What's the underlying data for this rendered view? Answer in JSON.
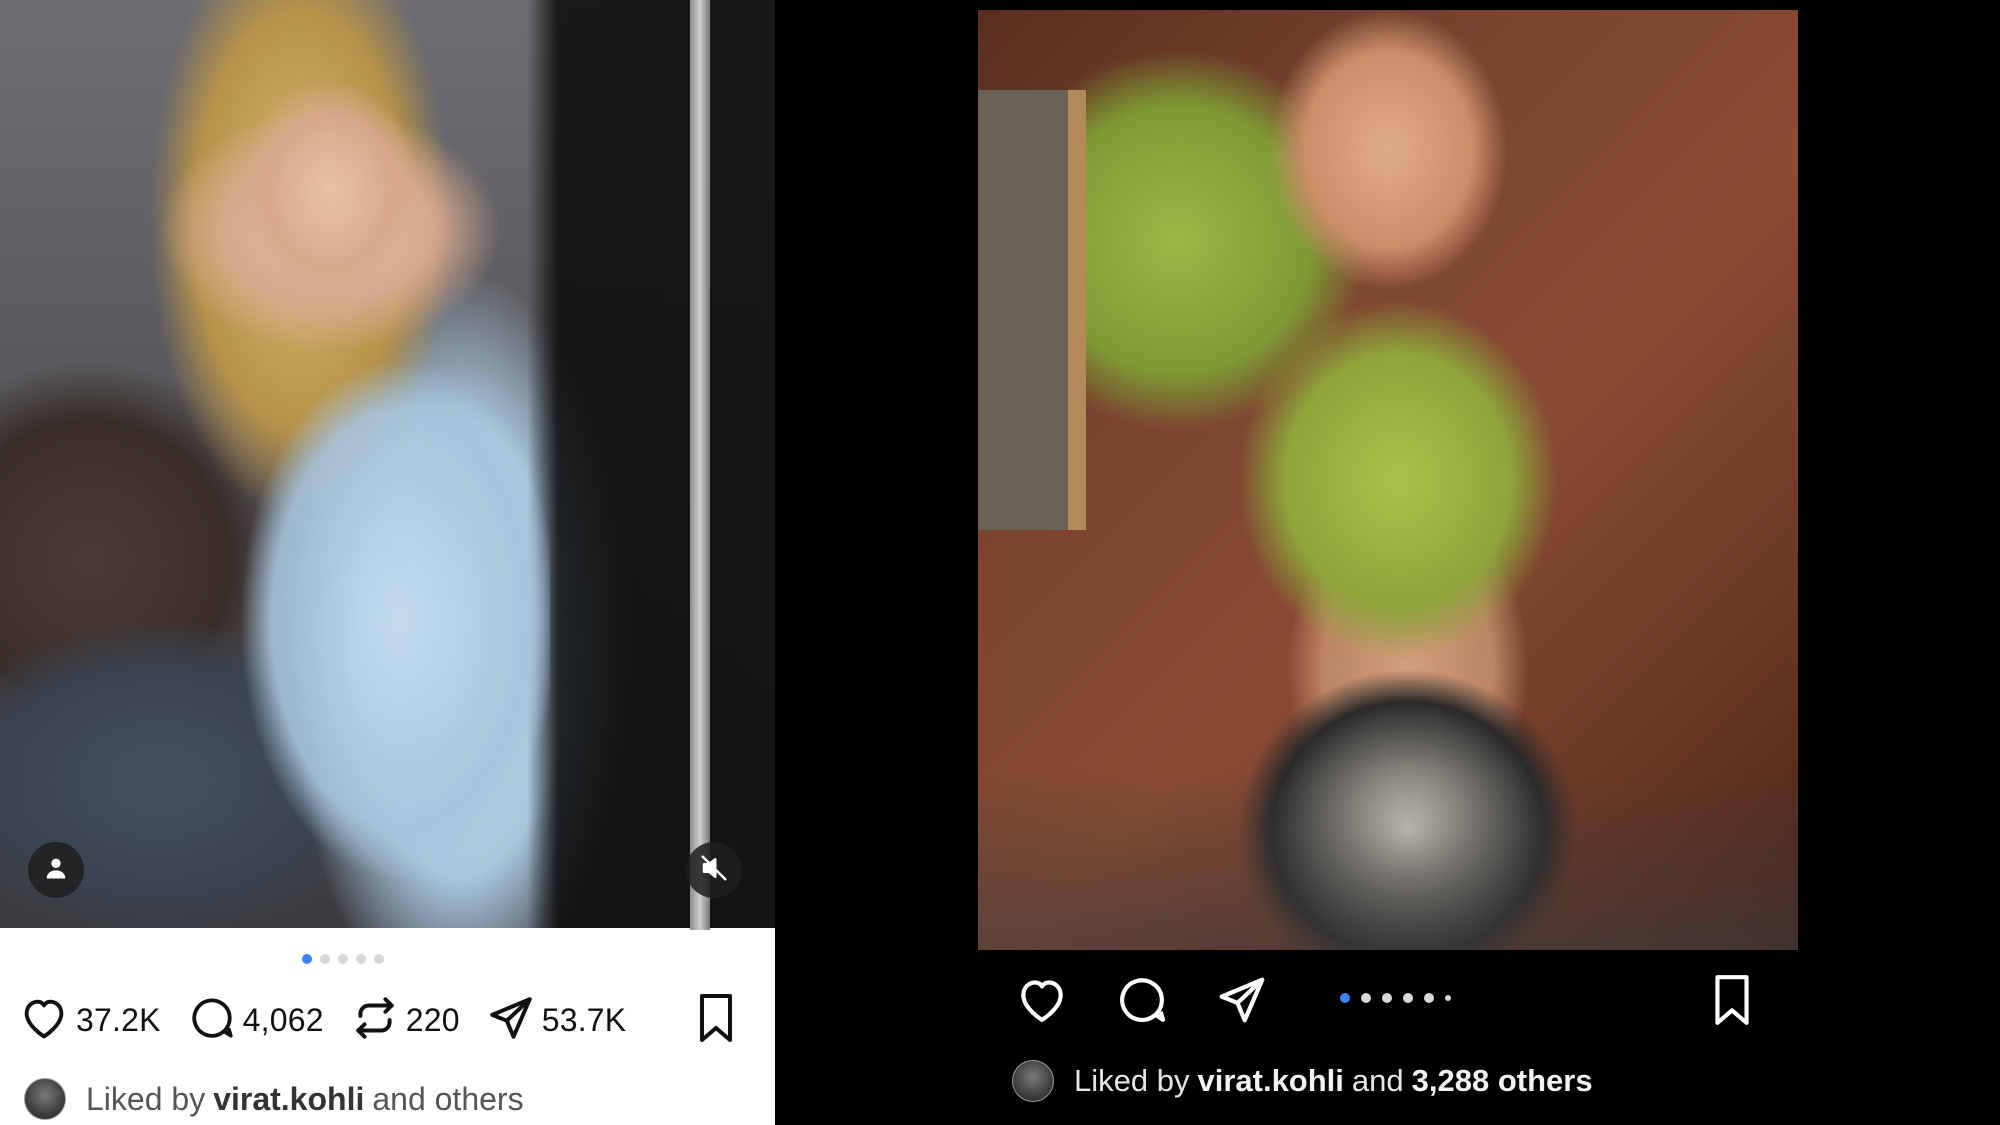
{
  "left_post": {
    "likes": "37.2K",
    "comments": "4,062",
    "reposts": "220",
    "shares": "53.7K",
    "carousel": {
      "total": 5,
      "active": 1
    },
    "liked_by": {
      "prefix": "Liked by",
      "user": "virat.kohli",
      "suffix": "and others"
    }
  },
  "right_post": {
    "carousel": {
      "total": 6,
      "active": 1
    },
    "liked_by": {
      "prefix": "Liked by",
      "user": "virat.kohli",
      "conjunction": "and",
      "others": "3,288 others"
    }
  },
  "icons": {
    "like": "heart-icon",
    "comment": "comment-icon",
    "repost": "repost-icon",
    "share": "send-icon",
    "save": "bookmark-icon",
    "tag": "person-icon",
    "mute": "muted-speaker-icon"
  },
  "colors": {
    "accent": "#3b82f6",
    "light_bg": "#ffffff",
    "dark_bg": "#000000"
  }
}
